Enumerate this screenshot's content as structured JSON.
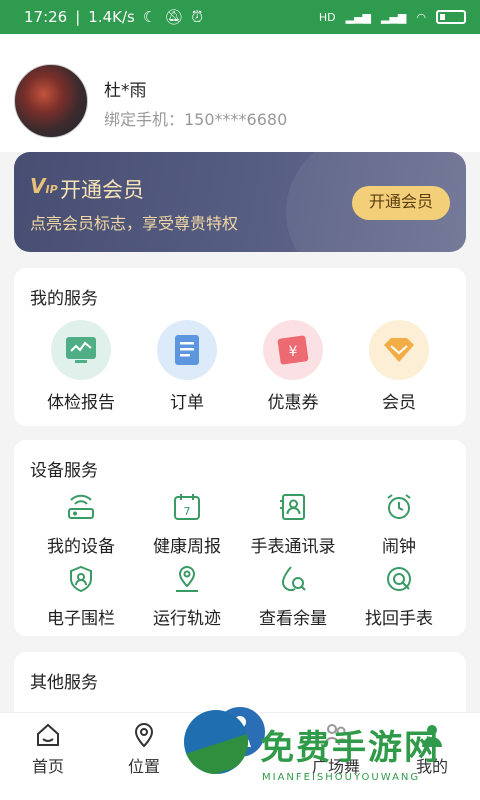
{
  "status_bar": {
    "time": "17:26",
    "speed": "1.4K/s",
    "network": "HD",
    "battery": "low"
  },
  "profile": {
    "name": "杜*雨",
    "phone": "绑定手机：150****6680"
  },
  "vip": {
    "logo": "VIP",
    "title": "开通会员",
    "subtitle": "点亮会员标志，享受尊贵特权",
    "button": "开通会员",
    "accent": "#f4cf79"
  },
  "my_services": {
    "title": "我的服务",
    "items": [
      {
        "label": "体检报告",
        "icon": "health-report-icon",
        "color": "#3fa37a"
      },
      {
        "label": "订单",
        "icon": "order-icon",
        "color": "#3d7fd6"
      },
      {
        "label": "优惠券",
        "icon": "coupon-icon",
        "color": "#e8505b"
      },
      {
        "label": "会员",
        "icon": "member-diamond-icon",
        "color": "#f0a23a"
      }
    ]
  },
  "device_services": {
    "title": "设备服务",
    "items": [
      {
        "label": "我的设备",
        "icon": "router-icon"
      },
      {
        "label": "健康周报",
        "icon": "calendar-icon"
      },
      {
        "label": "手表通讯录",
        "icon": "contacts-icon"
      },
      {
        "label": "闹钟",
        "icon": "alarm-clock-icon"
      },
      {
        "label": "电子围栏",
        "icon": "shield-user-icon"
      },
      {
        "label": "运行轨迹",
        "icon": "location-track-icon"
      },
      {
        "label": "查看余量",
        "icon": "balance-search-icon"
      },
      {
        "label": "找回手表",
        "icon": "find-watch-icon"
      }
    ],
    "color": "#3a9a64"
  },
  "other_services": {
    "title": "其他服务"
  },
  "tabbar": {
    "items": [
      {
        "label": "首页",
        "icon": "home-icon"
      },
      {
        "label": "位置",
        "icon": "location-icon"
      },
      {
        "label": "",
        "icon": "center-icon"
      },
      {
        "label": "广场舞",
        "icon": "dance-icon"
      },
      {
        "label": "我的",
        "icon": "profile-icon"
      }
    ]
  },
  "watermark": {
    "text": "免费手游网",
    "sub": "MIANFEISHOUYOUWANG"
  }
}
